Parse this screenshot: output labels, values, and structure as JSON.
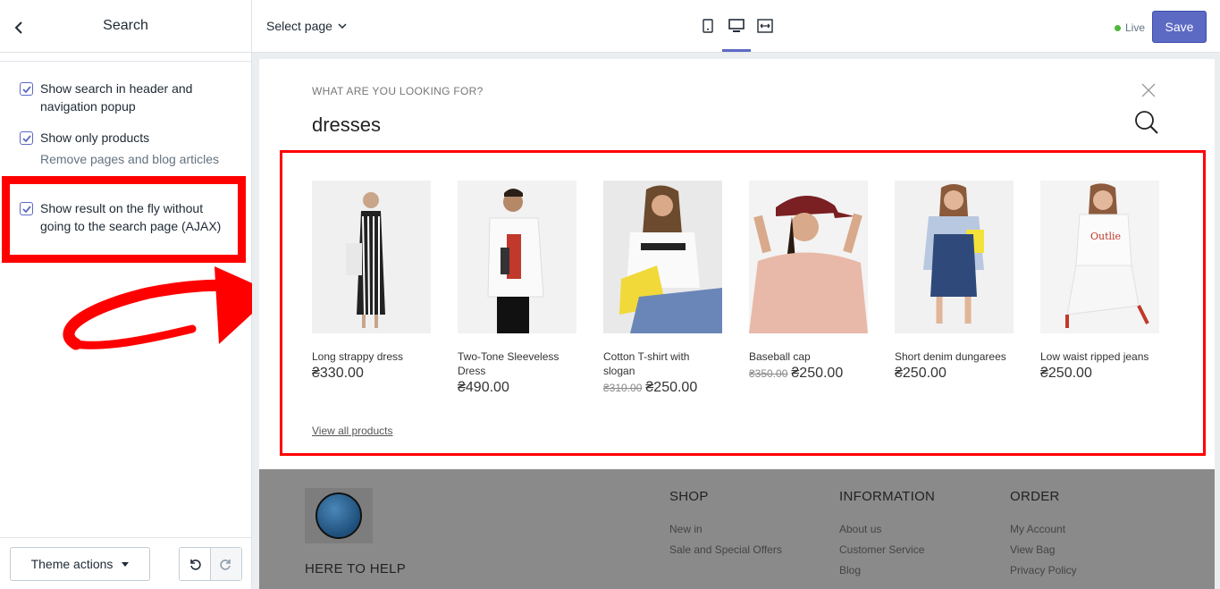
{
  "sidebar": {
    "title": "Search",
    "options": [
      {
        "label": "Show search in header and navigation popup",
        "checked": true
      },
      {
        "label": "Show only products",
        "help": "Remove pages and blog articles from search results",
        "checked": true
      },
      {
        "label": "Show result on the fly without going to the search page (AJAX)",
        "checked": true
      }
    ],
    "theme_actions_label": "Theme actions"
  },
  "topbar": {
    "select_page_label": "Select page",
    "live_label": "Live",
    "save_label": "Save",
    "active_device": "desktop"
  },
  "preview": {
    "search_prompt": "WHAT ARE YOU LOOKING FOR?",
    "query": "dresses",
    "products": [
      {
        "name": "Long strappy dress",
        "price": "₴330.00",
        "old_price": ""
      },
      {
        "name": "Two-Tone Sleeveless Dress",
        "price": "₴490.00",
        "old_price": ""
      },
      {
        "name": "Cotton T-shirt with slogan",
        "price": "₴250.00",
        "old_price": "₴310.00"
      },
      {
        "name": "Baseball cap",
        "price": "₴250.00",
        "old_price": "₴350.00"
      },
      {
        "name": "Short denim dungarees",
        "price": "₴250.00",
        "old_price": ""
      },
      {
        "name": "Low waist ripped jeans",
        "price": "₴250.00",
        "old_price": ""
      }
    ],
    "view_all_label": "View all products",
    "footer": {
      "help_heading": "HERE TO HELP",
      "columns": [
        {
          "heading": "SHOP",
          "links": [
            "New in",
            "Sale and Special Offers"
          ]
        },
        {
          "heading": "INFORMATION",
          "links": [
            "About us",
            "Customer Service",
            "Blog"
          ]
        },
        {
          "heading": "ORDER",
          "links": [
            "My Account",
            "View Bag",
            "Privacy Policy"
          ]
        }
      ]
    }
  },
  "colors": {
    "accent": "#5c6ac4",
    "annotation": "#ff0000",
    "live": "#50b83c"
  }
}
